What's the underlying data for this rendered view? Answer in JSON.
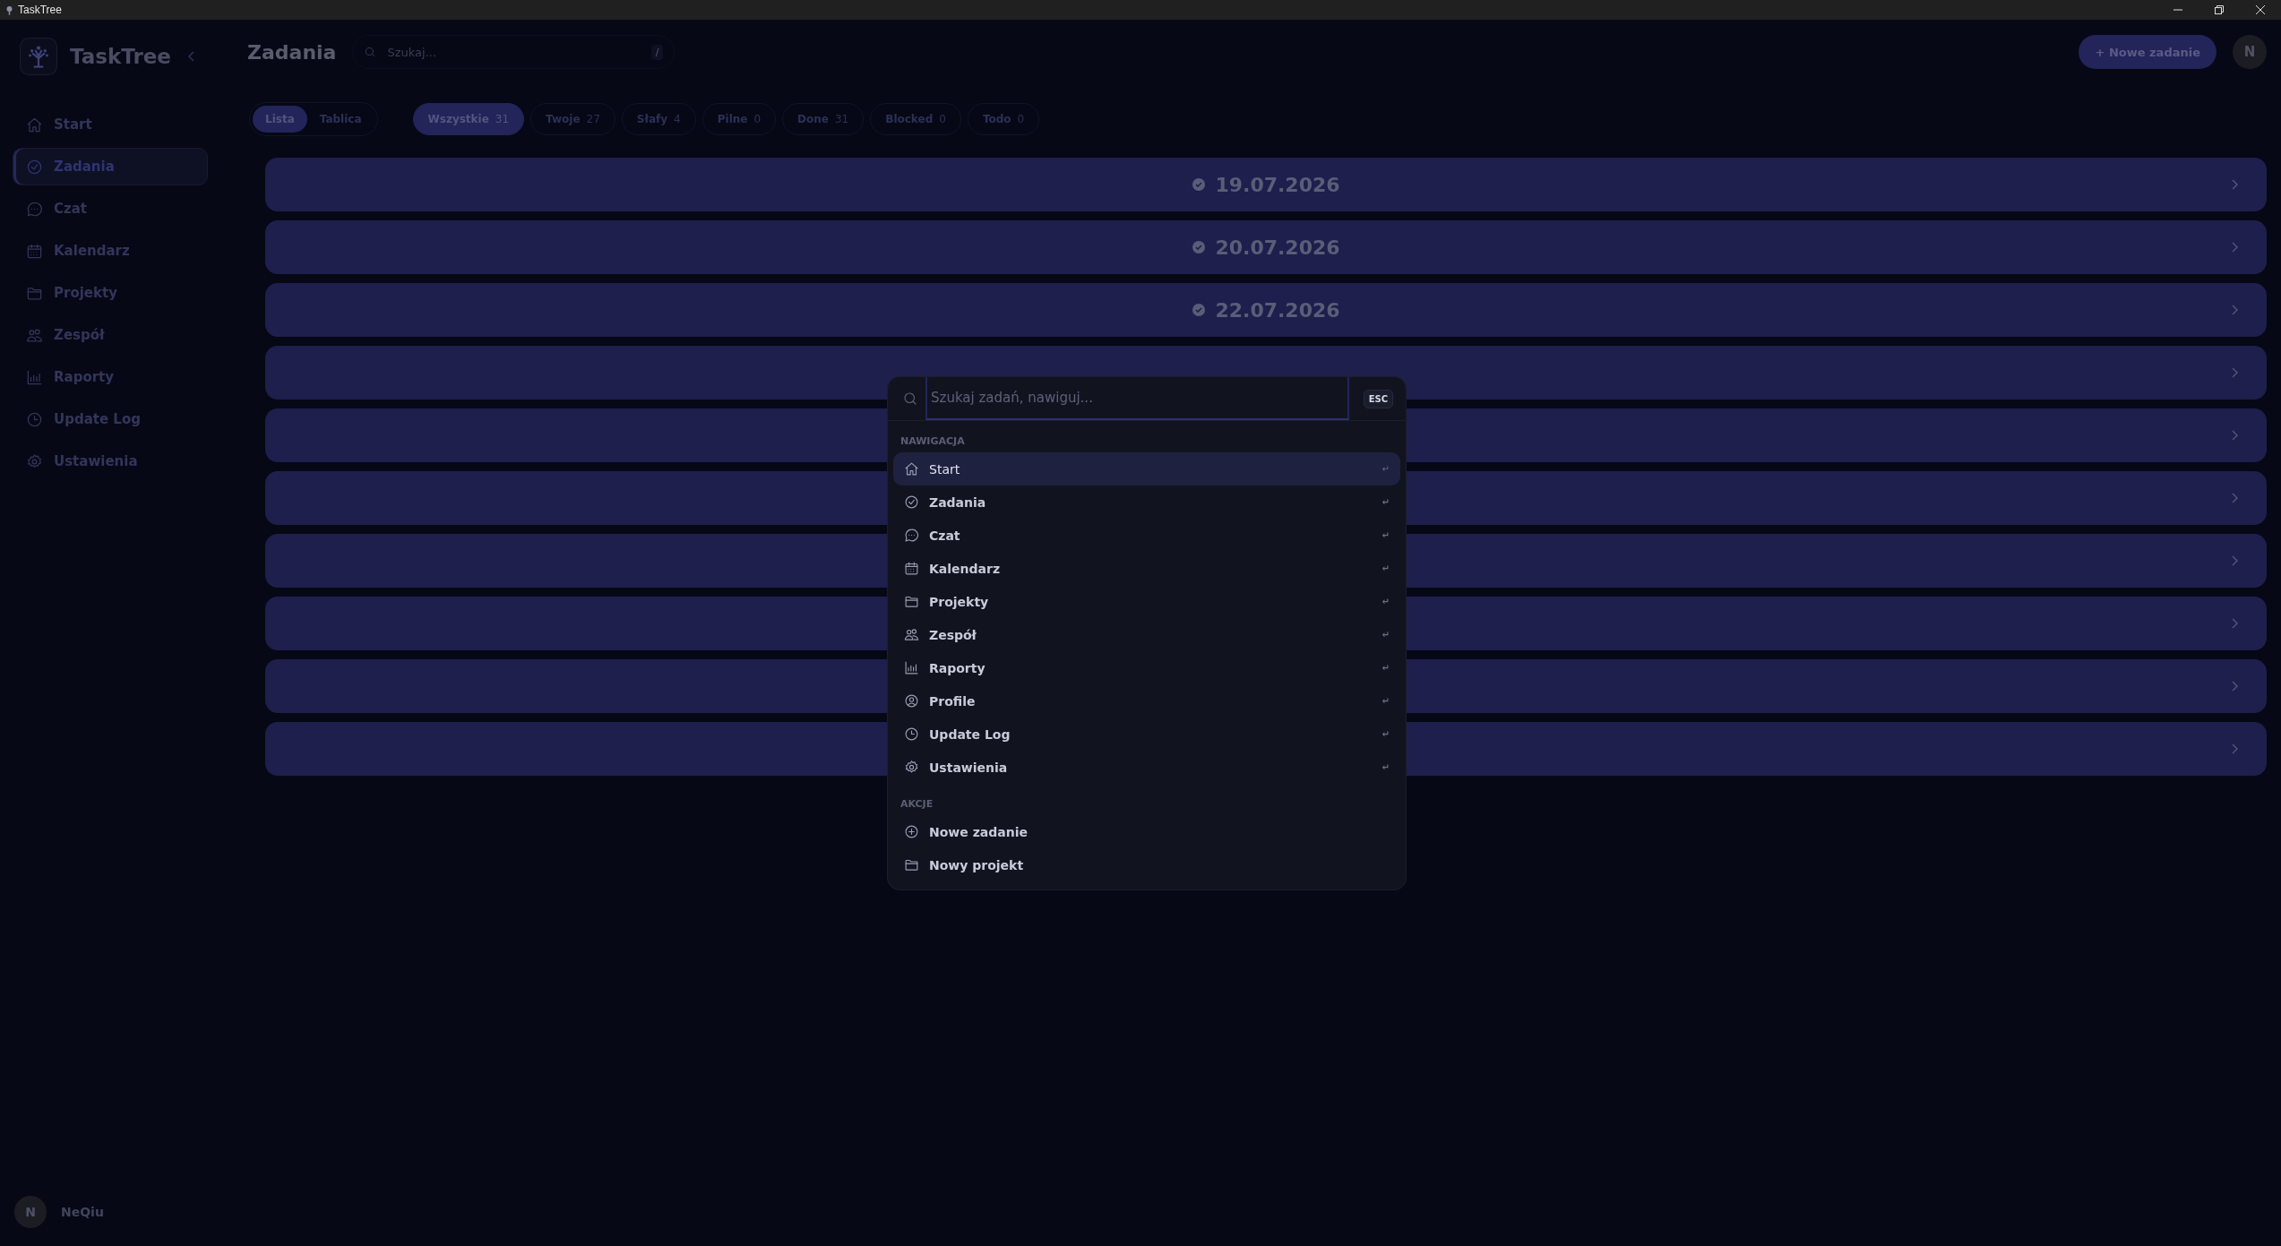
{
  "window": {
    "title": "TaskTree"
  },
  "sidebar": {
    "brand": "TaskTree",
    "items": [
      {
        "label": "Start",
        "selected": false
      },
      {
        "label": "Zadania",
        "selected": true
      },
      {
        "label": "Czat",
        "selected": false
      },
      {
        "label": "Kalendarz",
        "selected": false
      },
      {
        "label": "Projekty",
        "selected": false
      },
      {
        "label": "Zespół",
        "selected": false
      },
      {
        "label": "Raporty",
        "selected": false
      },
      {
        "label": "Update Log",
        "selected": false
      },
      {
        "label": "Ustawienia",
        "selected": false
      }
    ],
    "user": {
      "initial": "N",
      "name": "NeQiu"
    }
  },
  "header": {
    "title": "Zadania",
    "search": {
      "placeholder": "Szukaj...",
      "shortcut": "/"
    },
    "new_button": "+ Nowe zadanie",
    "avatar": "N"
  },
  "view_toggle": [
    {
      "label": "Lista",
      "selected": true
    },
    {
      "label": "Tablica",
      "selected": false
    }
  ],
  "filters": [
    {
      "label": "Wszystkie",
      "count": "31",
      "selected": true
    },
    {
      "label": "Twoje",
      "count": "27",
      "selected": false
    },
    {
      "label": "Słafy",
      "count": "4",
      "selected": false
    },
    {
      "label": "Pilne",
      "count": "0",
      "selected": false
    },
    {
      "label": "Done",
      "count": "31",
      "selected": false
    },
    {
      "label": "Blocked",
      "count": "0",
      "selected": false
    },
    {
      "label": "Todo",
      "count": "0",
      "selected": false
    }
  ],
  "groups": [
    {
      "date": "19.07.2026",
      "expanded": false
    },
    {
      "date": "20.07.2026",
      "expanded": false
    },
    {
      "date": "22.07.2026",
      "expanded": false
    },
    {
      "expanded": false
    },
    {
      "expanded": false
    },
    {
      "expanded": false
    },
    {
      "expanded": false
    },
    {
      "expanded": false
    },
    {
      "expanded": false
    },
    {
      "expanded": false
    }
  ],
  "command_palette": {
    "search": {
      "placeholder": "Szukaj zadań, nawiguj...",
      "shortcut": "ESC"
    },
    "sections": [
      {
        "title": "NAWIGACJA",
        "items": [
          {
            "label": "Start",
            "selected": true,
            "hint": "↵"
          },
          {
            "label": "Zadania",
            "selected": false,
            "hint": "↵"
          },
          {
            "label": "Czat",
            "selected": false,
            "hint": "↵"
          },
          {
            "label": "Kalendarz",
            "selected": false,
            "hint": "↵"
          },
          {
            "label": "Projekty",
            "selected": false,
            "hint": "↵"
          },
          {
            "label": "Zespół",
            "selected": false,
            "hint": "↵"
          },
          {
            "label": "Raporty",
            "selected": false,
            "hint": "↵"
          },
          {
            "label": "Profile",
            "selected": false,
            "hint": "↵"
          },
          {
            "label": "Update Log",
            "selected": false,
            "hint": "↵"
          },
          {
            "label": "Ustawienia",
            "selected": false,
            "hint": "↵"
          }
        ]
      },
      {
        "title": "AKCJE",
        "items": [
          {
            "label": "Nowe zadanie",
            "selected": false
          },
          {
            "label": "Nowy projekt",
            "selected": false
          }
        ]
      }
    ]
  }
}
